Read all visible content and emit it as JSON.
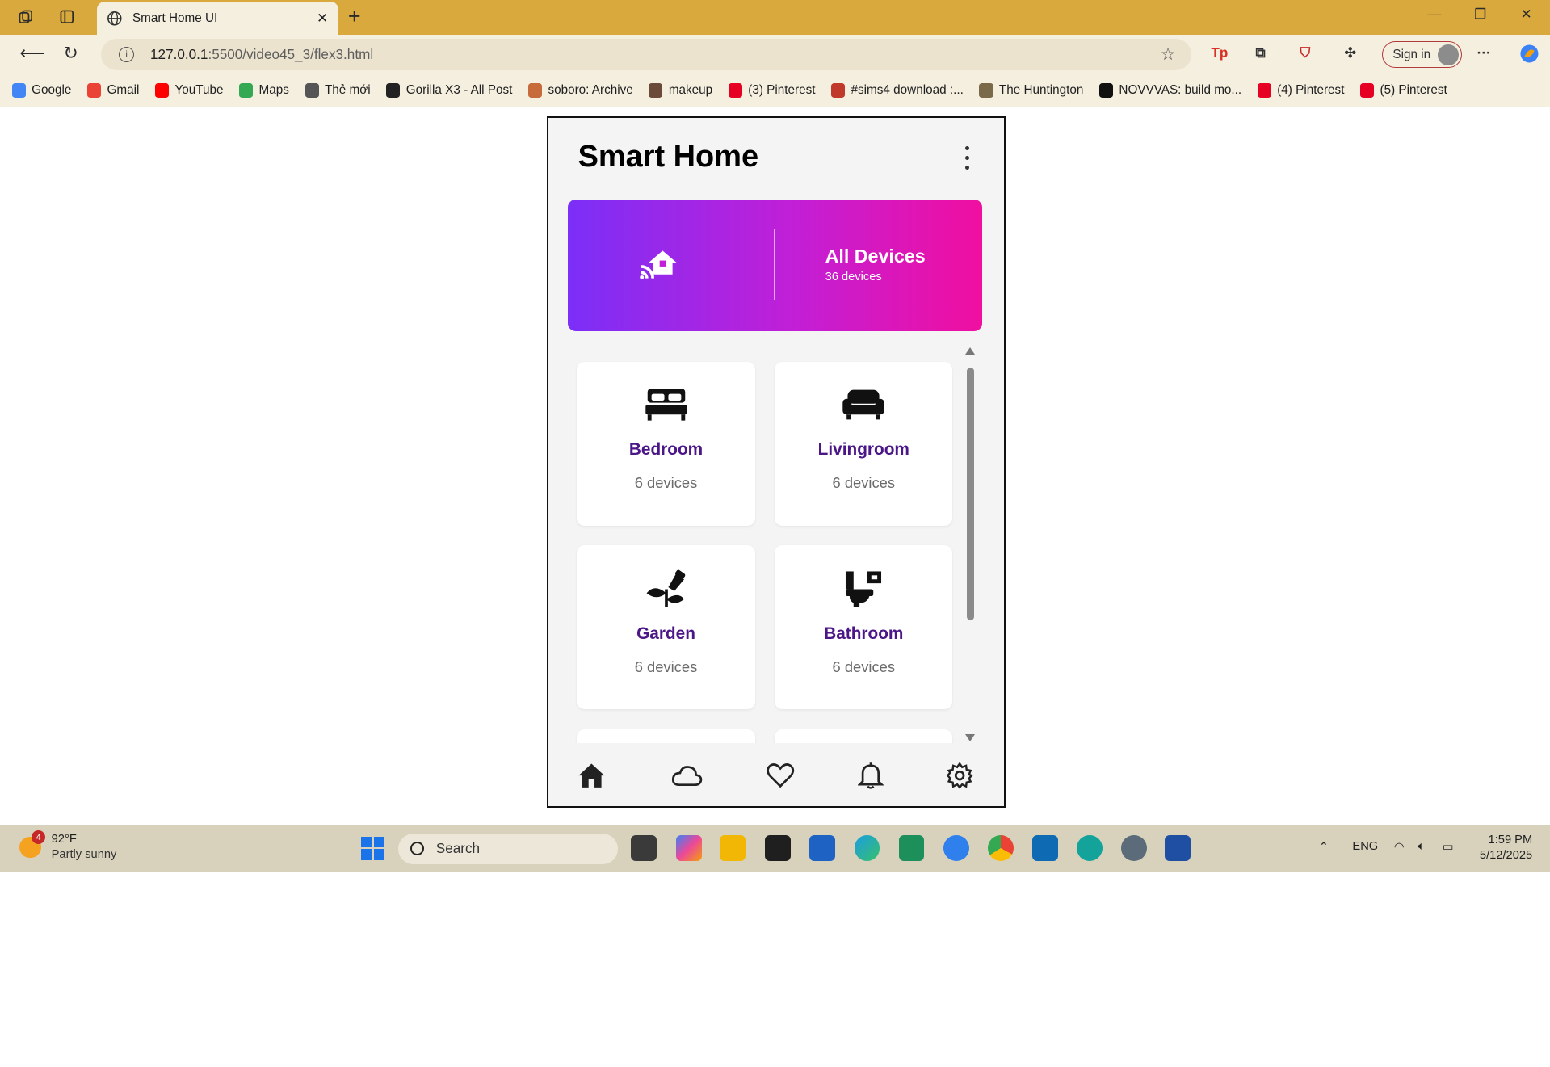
{
  "browser": {
    "tab_title": "Smart Home UI",
    "url_host": "127.0.0.1",
    "url_path": ":5500/video45_3/flex3.html",
    "signin_label": "Sign in",
    "bookmarks": [
      {
        "label": "Google",
        "color": "#4285f4"
      },
      {
        "label": "Gmail",
        "color": "#ea4335"
      },
      {
        "label": "YouTube",
        "color": "#ff0000"
      },
      {
        "label": "Maps",
        "color": "#34a853"
      },
      {
        "label": "Thẻ mới",
        "color": "#555555"
      },
      {
        "label": "Gorilla X3 - All Post",
        "color": "#222222"
      },
      {
        "label": "soboro: Archive",
        "color": "#c76b3a"
      },
      {
        "label": "makeup",
        "color": "#6b4a3a"
      },
      {
        "label": "(3) Pinterest",
        "color": "#e60023"
      },
      {
        "label": "#sims4 download :...",
        "color": "#c0392b"
      },
      {
        "label": "The Huntington",
        "color": "#7a6a4a"
      },
      {
        "label": "NOVVVAS: build mo...",
        "color": "#111111"
      },
      {
        "label": "(4) Pinterest",
        "color": "#e60023"
      },
      {
        "label": "(5) Pinterest",
        "color": "#e60023"
      }
    ]
  },
  "app": {
    "title": "Smart Home",
    "hero": {
      "title": "All Devices",
      "subtitle": "36 devices",
      "gradient_start": "#7b2ff7",
      "gradient_end": "#f00fa0"
    },
    "rooms": [
      {
        "name": "Bedroom",
        "count": "6 devices",
        "icon": "bed-icon"
      },
      {
        "name": "Livingroom",
        "count": "6 devices",
        "icon": "sofa-icon"
      },
      {
        "name": "Garden",
        "count": "6 devices",
        "icon": "plant-icon"
      },
      {
        "name": "Bathroom",
        "count": "6 devices",
        "icon": "toilet-icon"
      }
    ],
    "room_name_color": "#4b1687",
    "bottom_nav": [
      "home-icon",
      "cloud-icon",
      "heart-icon",
      "bell-icon",
      "gear-icon"
    ]
  },
  "taskbar": {
    "weather_temp": "92°F",
    "weather_desc": "Partly sunny",
    "weather_badge": "4",
    "search_placeholder": "Search",
    "lang": "ENG",
    "time": "1:59 PM",
    "date": "5/12/2025"
  }
}
